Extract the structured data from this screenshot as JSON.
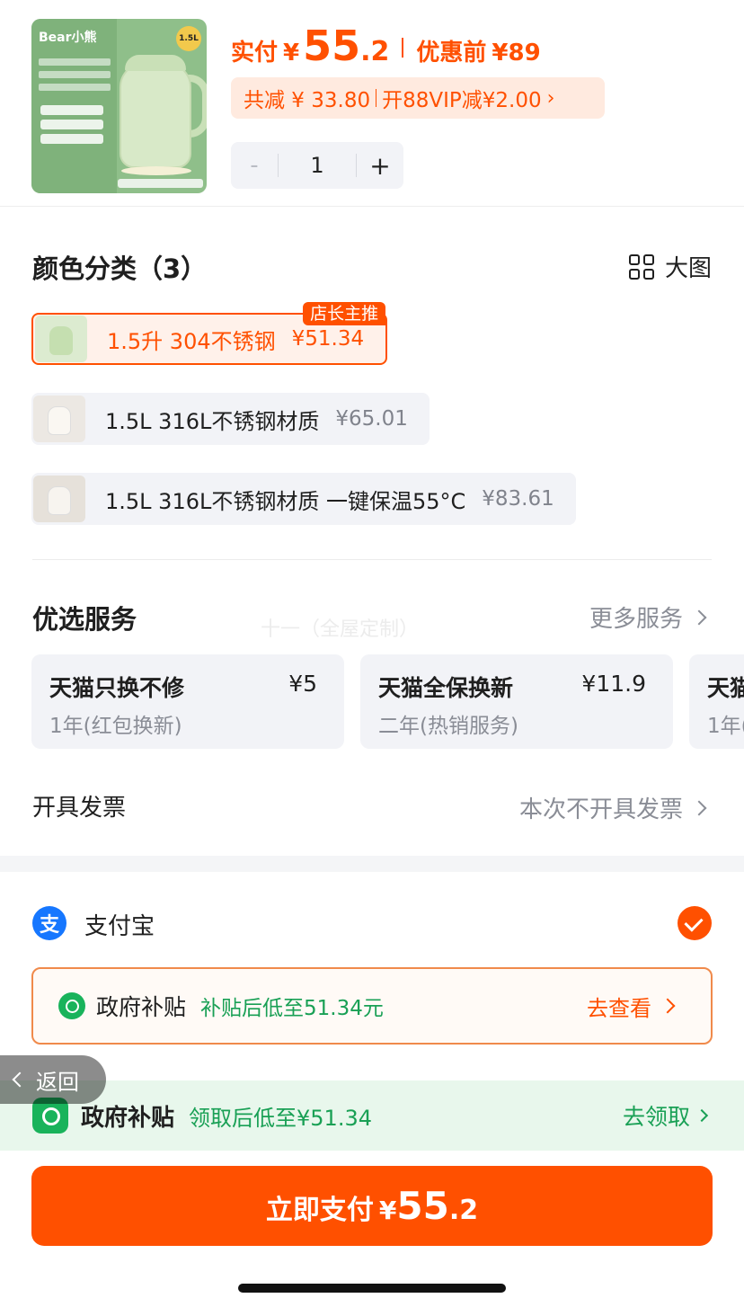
{
  "product": {
    "thumb_brand": "Bear小熊",
    "thumb_size": "1.5L",
    "paid_label": "实付",
    "currency": "¥",
    "price_int": "55",
    "price_dec": ".2",
    "before_label": "优惠前",
    "before_price": "¥89",
    "discount_total": "共减 ¥ 33.80",
    "vip_discount": "开88VIP减¥2.00",
    "quantity": "1",
    "minus": "-",
    "plus": "+"
  },
  "color_section": {
    "title": "颜色分类（3）",
    "big_image_label": "大图",
    "options": [
      {
        "label": "1.5升 304不锈钢",
        "price": "¥51.34",
        "badge": "店长主推",
        "selected": true
      },
      {
        "label": "1.5L 316L不锈钢材质",
        "price": "¥65.01",
        "selected": false
      },
      {
        "label": "1.5L 316L不锈钢材质 一键保温55°C",
        "price": "¥83.61",
        "selected": false
      }
    ]
  },
  "services": {
    "title": "优选服务",
    "more_label": "更多服务",
    "watermark": "十一（全屋定制）",
    "cards": [
      {
        "name": "天猫只换不修",
        "fee": "¥5",
        "desc": "1年(红包换新)"
      },
      {
        "name": "天猫全保换新",
        "fee": "¥11.9",
        "desc": "二年(热销服务)"
      },
      {
        "name": "天猫",
        "fee": "",
        "desc": "1年("
      }
    ]
  },
  "invoice": {
    "label": "开具发票",
    "value": "本次不开具发票"
  },
  "payment": {
    "method_icon": "支",
    "method_label": "支付宝",
    "subsidy_title": "政府补贴",
    "subsidy_detail": "补贴后低至51.34元",
    "subsidy_action": "去查看"
  },
  "back_label": "返回",
  "gov_banner": {
    "title": "政府补贴",
    "detail": "领取后低至¥51.34",
    "action": "去领取"
  },
  "pay_button": {
    "label": "立即支付",
    "currency": "¥",
    "price_int": "55",
    "price_dec": ".2"
  },
  "colors": {
    "accent": "#ff5000",
    "green": "#19a055",
    "alipay_blue": "#1677ff"
  }
}
